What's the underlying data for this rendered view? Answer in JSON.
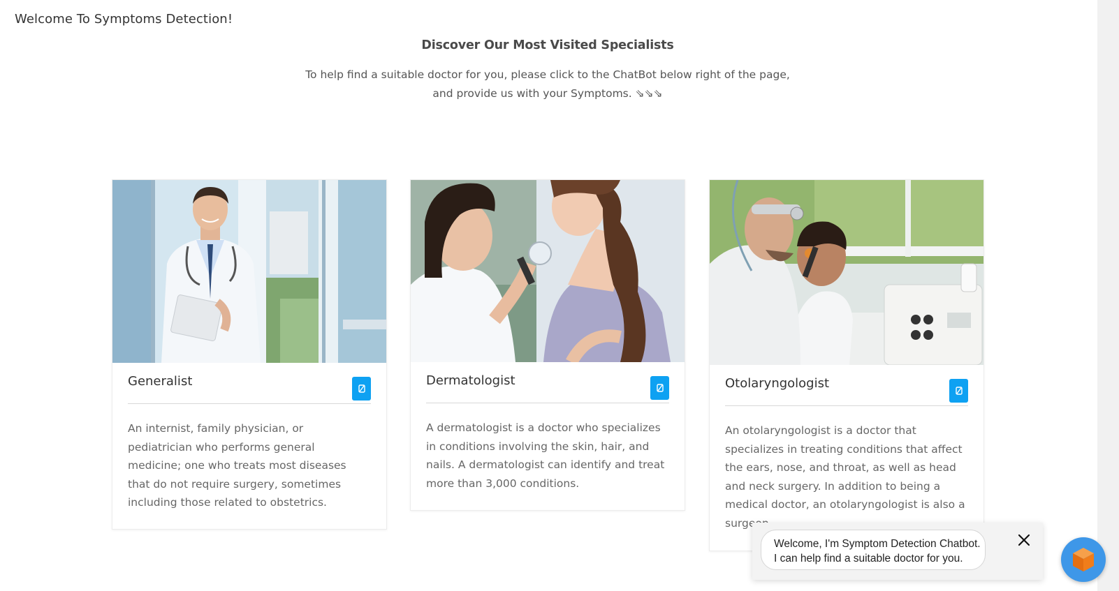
{
  "page": {
    "welcome": "Welcome To Symptoms Detection!",
    "headline": "Discover Our Most Visited Specialists",
    "intro_line1": "To help find a suitable doctor for you, please click to the ChatBot below right of the page,",
    "intro_line2": "and provide us with your Symptoms. ⇘⇘⇘"
  },
  "cards": [
    {
      "title": "Generalist",
      "description": "An internist, family physician, or pediatrician who performs general medicine; one who treats most diseases that do not require surgery, sometimes including those related to obstetrics.",
      "image": "doctor-portrait-photo",
      "button_icon": "link-icon"
    },
    {
      "title": "Dermatologist",
      "description": "A dermatologist is a doctor who specializes in conditions involving the skin, hair, and nails. A dermatologist can identify and treat more than 3,000 conditions.",
      "image": "dermatologist-examining-patient-photo",
      "button_icon": "link-icon"
    },
    {
      "title": "Otolaryngologist",
      "description": "An otolaryngologist is a doctor that specializes in treating conditions that affect the ears, nose, and throat, as well as head and neck surgery. In addition to being a medical doctor, an otolaryngologist is also a surgeon.",
      "image": "ent-doctor-examining-child-ear-photo",
      "button_icon": "link-icon"
    }
  ],
  "chatbot": {
    "line1": "Welcome, I'm Symptom Detection Chatbot.",
    "line2": "I can help find a suitable doctor for you.",
    "close_icon": "close-icon",
    "launcher_icon": "cube-icon"
  },
  "colors": {
    "accent": "#0ea1f2",
    "launcher": "#3e97e8",
    "launcher_icon": "#f07d1a"
  }
}
